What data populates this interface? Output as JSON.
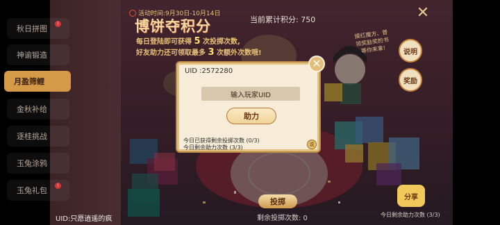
{
  "sidebar": {
    "items": [
      {
        "label": "秋日拼图",
        "badge": "!"
      },
      {
        "label": "神谕锻造"
      },
      {
        "label": "月盈筛鲤"
      },
      {
        "label": "金秋补给"
      },
      {
        "label": "逐桂挑战"
      },
      {
        "label": "玉兔涂鸦"
      },
      {
        "label": "玉兔礼包",
        "badge": "!"
      }
    ],
    "uid_label": "UID:只愿逍遥的疯"
  },
  "header": {
    "event_time": "活动时间:9月30日-10月14日",
    "title": "博饼夺积分",
    "subtitle_line1_a": "每日登陆即可获得",
    "subtitle_line1_num": "5",
    "subtitle_line1_b": "次投掷次数,",
    "subtitle_line2_a": "好友助力还可领取最多",
    "subtitle_line2_num": "3",
    "subtitle_line2_b": "次额外次数哦!",
    "score": "当前累计积分: 750"
  },
  "note": "摸红魔方、普领奖励奖的书等你来拿!",
  "buttons": {
    "explain": "说明",
    "reward": "奖励",
    "throw": "投掷",
    "share": "分享"
  },
  "footer": {
    "remain_throw": "剩余投掷次数: 0",
    "remain_help": "今日剩余助力次数 (3/3)"
  },
  "modal": {
    "uid": "UID :2572280",
    "input_placeholder": "输入玩家UID",
    "help_button": "助力",
    "stat_received": "今日已获得剩余投掷次数 (0/3)",
    "stat_remaining": "今日剩余助力次数 (3/3)",
    "icon_label": "说"
  },
  "colors": {
    "accent": "#d59a48",
    "title": "#f6d7a0",
    "modal_bg": "#f6ecd8"
  }
}
